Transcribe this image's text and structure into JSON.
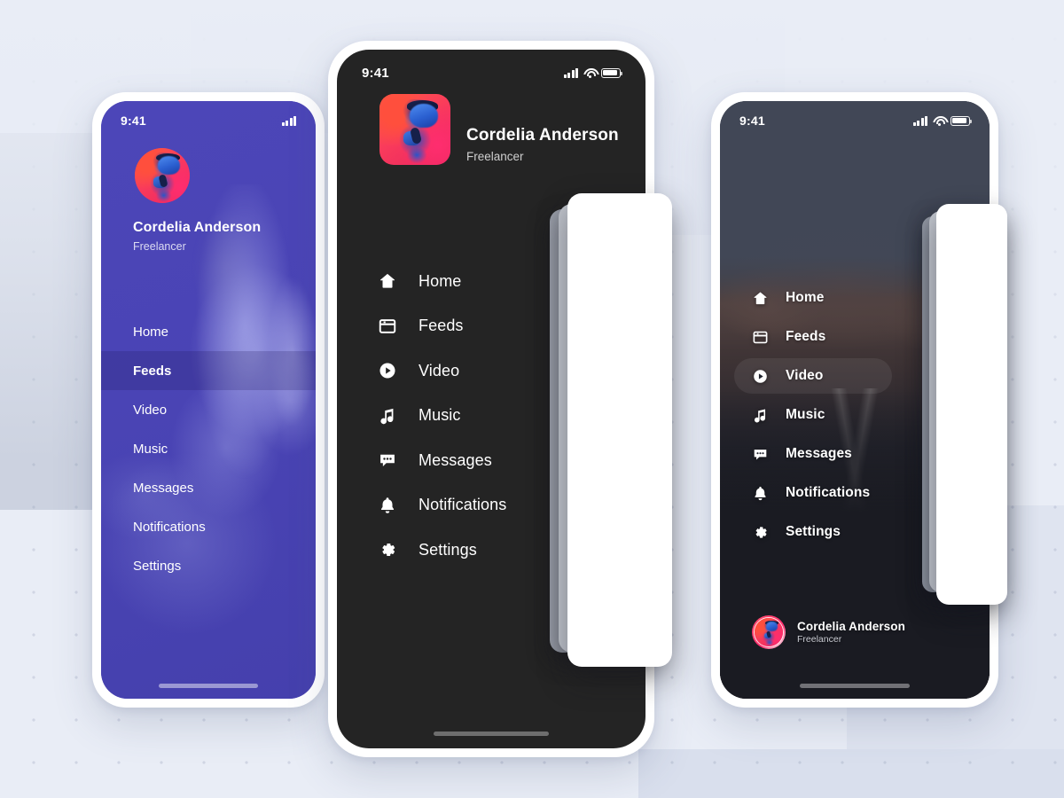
{
  "background": {
    "accent_purple": "#4a44b5",
    "dark": "#242424",
    "slate": "#414756",
    "page_bg": "#e9edf6"
  },
  "status_bar": {
    "time": "9:41",
    "signal_icon": "signal-bars-icon",
    "wifi_icon": "wifi-icon",
    "battery_icon": "battery-icon"
  },
  "profile": {
    "name": "Cordelia Anderson",
    "role": "Freelancer",
    "avatar_icon": "user-avatar-photo"
  },
  "menu": {
    "items": [
      {
        "label": "Home",
        "icon": "home-icon"
      },
      {
        "label": "Feeds",
        "icon": "feeds-window-icon"
      },
      {
        "label": "Video",
        "icon": "video-play-circle-icon"
      },
      {
        "label": "Music",
        "icon": "music-note-icon"
      },
      {
        "label": "Messages",
        "icon": "messages-chat-bubble-icon"
      },
      {
        "label": "Notifications",
        "icon": "notifications-bell-icon"
      },
      {
        "label": "Settings",
        "icon": "settings-gear-icon"
      }
    ]
  },
  "screens": {
    "left": {
      "name": "purple-drawer-screen",
      "active_item": "Feeds",
      "home_indicator": "home-indicator"
    },
    "center": {
      "name": "dark-drawer-screen",
      "active_item": "",
      "home_indicator": "home-indicator"
    },
    "right": {
      "name": "photo-drawer-screen",
      "active_item": "Video",
      "home_indicator": "home-indicator"
    }
  }
}
